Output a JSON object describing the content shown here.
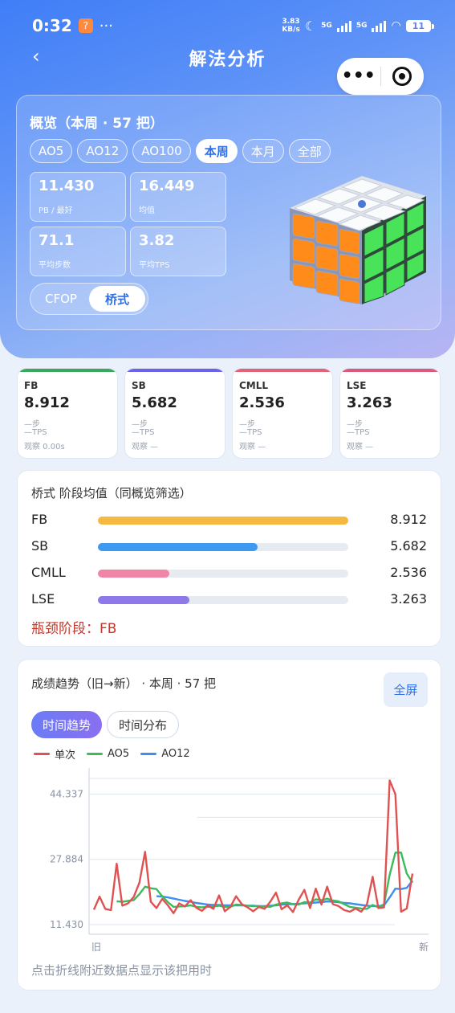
{
  "status": {
    "time": "0:32",
    "app_badge": "?",
    "more": "···",
    "net_speed_top": "3.83",
    "net_speed_bottom": "KB/s",
    "sig1": "5G",
    "sig2": "5G",
    "battery": "11"
  },
  "nav": {
    "back": "‹",
    "title": "解法分析"
  },
  "overview": {
    "title": "概览（本周 · 57 把）",
    "chips": [
      {
        "label": "AO5",
        "active": false
      },
      {
        "label": "AO12",
        "active": false
      },
      {
        "label": "AO100",
        "active": false
      },
      {
        "label": "本周",
        "active": true
      },
      {
        "label": "本月",
        "active": false
      },
      {
        "label": "全部",
        "active": false
      }
    ],
    "stats": [
      {
        "value": "11.430",
        "label": "PB / 最好"
      },
      {
        "value": "16.449",
        "label": "均值"
      },
      {
        "value": "71.1",
        "label": "平均步数"
      },
      {
        "value": "3.82",
        "label": "平均TPS"
      }
    ],
    "methods": [
      {
        "label": "CFOP",
        "active": false
      },
      {
        "label": "桥式",
        "active": true
      }
    ]
  },
  "phases": [
    {
      "name": "FB",
      "value": "8.912",
      "steps": "—步",
      "tps": "—TPS",
      "observe": "观察 0.00s",
      "color": "#3aa85c"
    },
    {
      "name": "SB",
      "value": "5.682",
      "steps": "—步",
      "tps": "—TPS",
      "observe": "观察 —",
      "color": "#6a63e8"
    },
    {
      "name": "CMLL",
      "value": "2.536",
      "steps": "—步",
      "tps": "—TPS",
      "observe": "观察 —",
      "color": "#e0637a"
    },
    {
      "name": "LSE",
      "value": "3.263",
      "steps": "—步",
      "tps": "—TPS",
      "observe": "观察 —",
      "color": "#d95a7a"
    }
  ],
  "segment_avg": {
    "title": "桥式 阶段均值（同概览筛选）",
    "rows": [
      {
        "name": "FB",
        "value": "8.912",
        "fraction": 1.0,
        "color": "#f5b942"
      },
      {
        "name": "SB",
        "value": "5.682",
        "fraction": 0.638,
        "color": "#3d9af0"
      },
      {
        "name": "CMLL",
        "value": "2.536",
        "fraction": 0.285,
        "color": "#ef86a8"
      },
      {
        "name": "LSE",
        "value": "3.263",
        "fraction": 0.366,
        "color": "#8f78ea"
      }
    ],
    "bottleneck": "瓶颈阶段：FB"
  },
  "trend": {
    "title": "成绩趋势（旧→新） · 本周 · 57 把",
    "fullscreen": "全屏",
    "tabs": [
      {
        "label": "时间趋势",
        "active": true
      },
      {
        "label": "时间分布",
        "active": false
      }
    ],
    "legend": [
      {
        "label": "单次",
        "color": "#e05252"
      },
      {
        "label": "AO5",
        "color": "#3dbb5a"
      },
      {
        "label": "AO12",
        "color": "#3d8ef0"
      }
    ],
    "hint": "点击折线附近数据点显示该把用时"
  },
  "chart_data": {
    "type": "line",
    "xlabel_left": "旧",
    "xlabel_right": "新",
    "y_ticks": [
      "44.337",
      "27.884",
      "11.430"
    ],
    "ylim": [
      11.43,
      49.5
    ],
    "series": [
      {
        "name": "单次",
        "color": "#e05252",
        "values": [
          15.2,
          18.5,
          15.4,
          15.1,
          26.8,
          16.2,
          16.8,
          18.4,
          22.0,
          29.8,
          17.2,
          15.6,
          17.9,
          16.3,
          14.3,
          16.8,
          16.0,
          17.6,
          15.7,
          14.9,
          16.3,
          15.4,
          18.8,
          14.8,
          15.9,
          18.6,
          16.6,
          15.8,
          14.8,
          15.9,
          15.4,
          17.2,
          19.5,
          15.3,
          16.3,
          14.6,
          17.7,
          20.2,
          15.6,
          20.5,
          16.5,
          21.0,
          16.6,
          16.1,
          15.1,
          14.7,
          15.5,
          14.7,
          16.6,
          23.5,
          15.6,
          15.8,
          47.8,
          44.3,
          14.7,
          15.5,
          24.3
        ]
      },
      {
        "name": "AO5",
        "values": [
          null,
          null,
          null,
          null,
          17.3,
          17.2,
          17.4,
          17.6,
          19.1,
          21.0,
          20.6,
          20.4,
          18.6,
          17.1,
          15.9,
          16.0,
          16.1,
          16.3,
          15.9,
          15.8,
          15.9,
          16.0,
          16.2,
          15.9,
          15.9,
          16.5,
          16.4,
          16.2,
          16.1,
          16.1,
          16.0,
          15.9,
          16.5,
          16.8,
          17.0,
          16.6,
          16.5,
          17.1,
          17.0,
          17.8,
          17.6,
          18.0,
          17.5,
          17.3,
          16.6,
          15.9,
          15.7,
          15.5,
          15.4,
          16.4,
          15.8,
          16.6,
          24.0,
          29.6,
          29.6,
          24.3,
          22.0
        ]
      },
      {
        "name": "AO12",
        "values": [
          null,
          null,
          null,
          null,
          null,
          null,
          null,
          null,
          null,
          null,
          null,
          18.6,
          18.5,
          18.3,
          18.0,
          17.7,
          17.4,
          17.2,
          16.9,
          16.7,
          16.5,
          16.4,
          16.4,
          16.3,
          16.3,
          16.3,
          16.3,
          16.2,
          16.2,
          16.1,
          16.1,
          16.2,
          16.3,
          16.5,
          16.6,
          16.6,
          16.7,
          16.8,
          16.9,
          17.0,
          17.1,
          17.3,
          17.2,
          17.1,
          16.9,
          16.8,
          16.6,
          16.4,
          16.2,
          16.1,
          16.1,
          16.3,
          18.3,
          20.5,
          20.4,
          20.7,
          22.5
        ]
      }
    ]
  }
}
